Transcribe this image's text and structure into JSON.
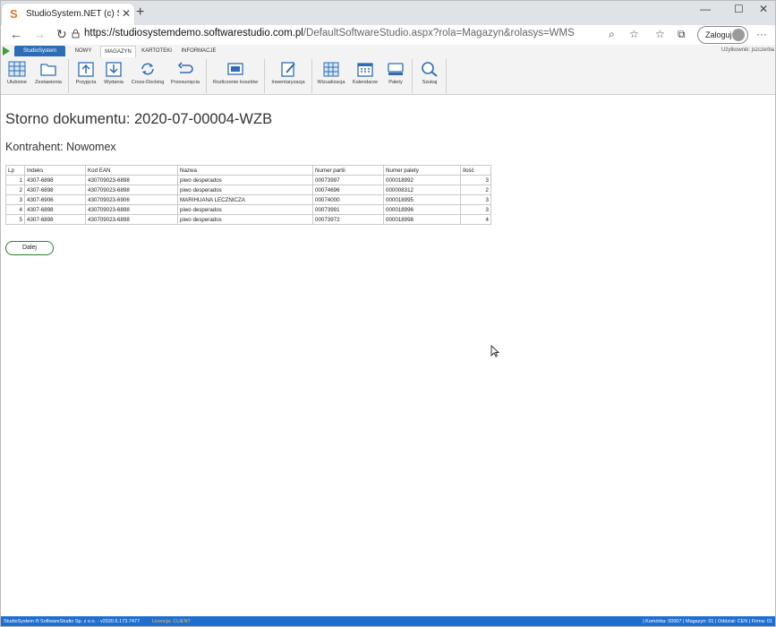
{
  "browser": {
    "tab_title": "StudioSystem.NET (c) SoftwareSt",
    "favicon_letter": "S",
    "url_host": "https://studiosystemdemo.softwarestudio.com.pl",
    "url_path": "/DefaultSoftwareStudio.aspx?rola=Magazyn&rolasys=WMS",
    "login_label": "Zaloguj",
    "icons": [
      "back-icon",
      "forward-icon",
      "refresh-icon",
      "lock-icon",
      "zoom-icon",
      "star-icon",
      "favorites-icon",
      "collections-icon",
      "more-icon"
    ]
  },
  "app_tabs": {
    "studio": "StudioSystem",
    "items": [
      "NOWY",
      "MAGAZYN",
      "KARTOTEKI",
      "INFORMACJE"
    ],
    "active": "MAGAZYN",
    "user_label": "Użytkownik: jszczerba"
  },
  "ribbon": {
    "buttons": [
      {
        "label": "Ulubione",
        "icon": "grid-icon"
      },
      {
        "label": "Zestawienia",
        "icon": "folder-icon"
      },
      {
        "label": "Przyjęcia",
        "icon": "receive-icon"
      },
      {
        "label": "Wydania",
        "icon": "issue-icon"
      },
      {
        "label": "Cross-Docking",
        "icon": "crossdock-icon"
      },
      {
        "label": "Przesunięcia",
        "icon": "move-icon"
      },
      {
        "label": "Rozliczenie kosztów",
        "icon": "cost-icon"
      },
      {
        "label": "Inwentaryzacja",
        "icon": "inventory-icon"
      },
      {
        "label": "Wizualizacja",
        "icon": "visualization-icon"
      },
      {
        "label": "Kalendarze",
        "icon": "calendar-icon"
      },
      {
        "label": "Palety",
        "icon": "pallet-icon"
      },
      {
        "label": "Szukaj",
        "icon": "search-icon"
      }
    ]
  },
  "main": {
    "title": "Storno dokumentu: 2020-07-00004-WZB",
    "contractor": "Kontrahent: Nowomex",
    "table": {
      "headers": [
        "Lp",
        "Indeks",
        "Kod EAN",
        "Nazwa",
        "Numer partii",
        "Numer palety",
        "Ilość"
      ],
      "rows": [
        [
          "1",
          "4307-6898",
          "430709023-6898",
          "piwo desperados",
          "00073997",
          "000018992",
          "3"
        ],
        [
          "2",
          "4307-6898",
          "430709023-6898",
          "piwo desperados",
          "00074696",
          "000008312",
          "2"
        ],
        [
          "3",
          "4307-6906",
          "430709023-6906",
          "MARIHUANA LECZNICZA",
          "00074000",
          "000018995",
          "3"
        ],
        [
          "4",
          "4307-6898",
          "430709023-6898",
          "piwo desperados",
          "00073991",
          "000018996",
          "3"
        ],
        [
          "5",
          "4307-6898",
          "430709023-6898",
          "piwo desperados",
          "00073972",
          "000018998",
          "4"
        ]
      ]
    },
    "next_button": "Dalej"
  },
  "status": {
    "left": "StudioSystem ® SoftwareStudio Sp. z o.o. - v2020.6.173.7477",
    "license": "Licencja: CLIENT",
    "right": "| Komórka: 00007 | Magazyn: 01 | Oddział: CEN | Firma: 01"
  },
  "colors": {
    "accent": "#2e6db5",
    "statusbar": "#1f6fd1",
    "license": "#f5c04a",
    "next_border": "#2e7d32",
    "play": "#3aa23a"
  }
}
